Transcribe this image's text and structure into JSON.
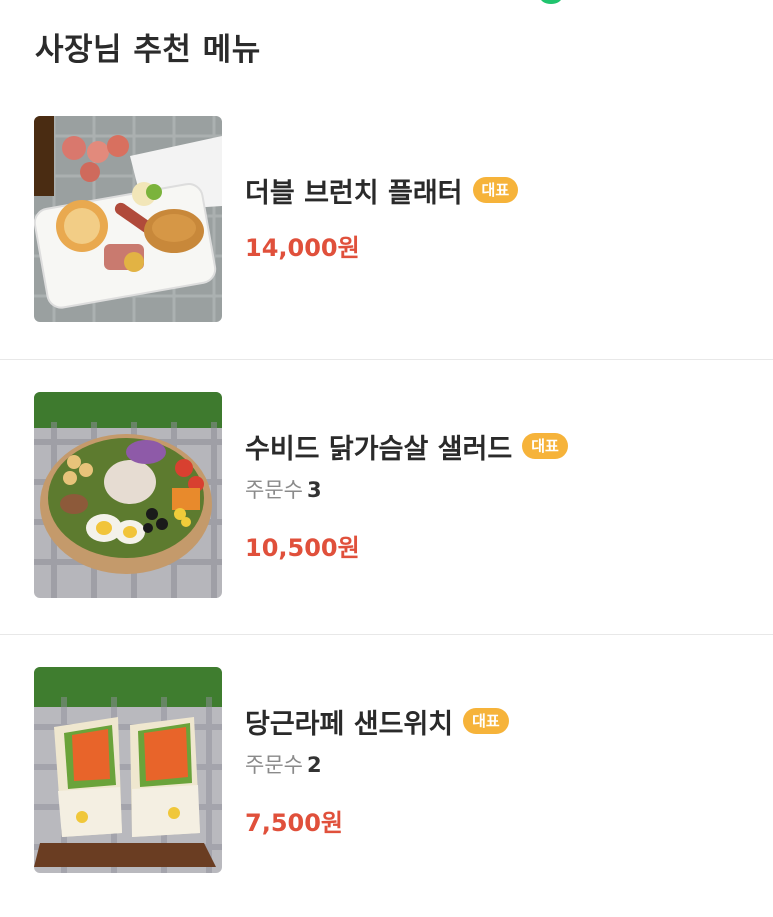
{
  "section": {
    "title": "사장님 추천 메뉴"
  },
  "menu_items": [
    {
      "image": "brunch-platter-photo",
      "name": "더블 브런치 플래터",
      "badge": "대표",
      "price": "14,000원"
    },
    {
      "image": "chicken-breast-salad-photo",
      "name": "수비드 닭가슴살 샐러드",
      "badge": "대표",
      "orders_label": "주문수",
      "orders_count": "3",
      "price": "10,500원"
    },
    {
      "image": "carrot-rapee-sandwich-photo",
      "name": "당근라페 샌드위치",
      "badge": "대표",
      "orders_label": "주문수",
      "orders_count": "2",
      "price": "7,500원"
    }
  ],
  "colors": {
    "badge": "#f6b33a",
    "price": "#e0503b",
    "accent_dot": "#20c46e"
  }
}
